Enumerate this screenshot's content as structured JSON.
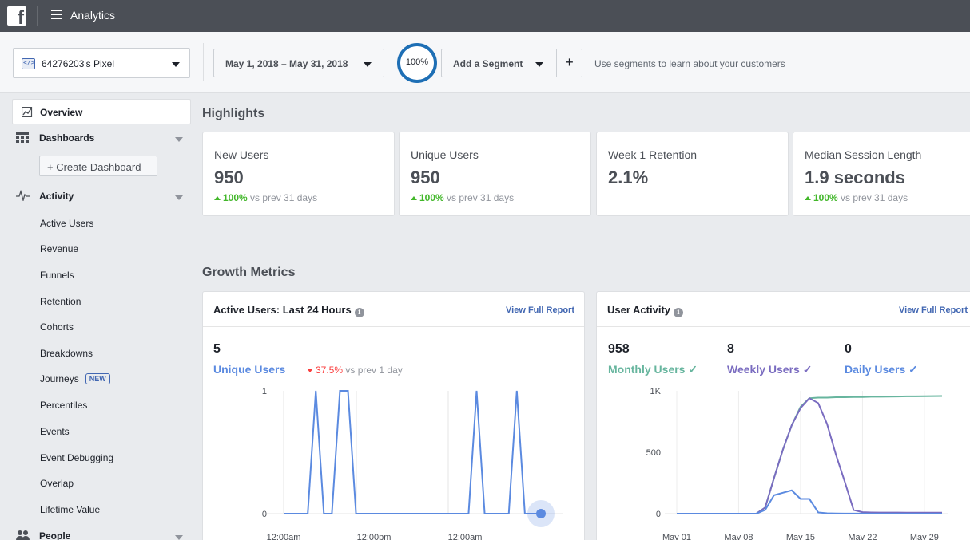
{
  "topbar": {
    "logo": "f",
    "title": "Analytics"
  },
  "toolbar": {
    "pixel_name": "64276203's Pixel",
    "date_range": "May 1, 2018 – May 31, 2018",
    "percent": "100%",
    "segment_label": "Add a Segment",
    "plus_label": "+",
    "segment_hint": "Use segments to learn about your customers"
  },
  "sidebar": {
    "overview": "Overview",
    "dashboards": "Dashboards",
    "create_dashboard": "+ Create Dashboard",
    "activity": "Activity",
    "activity_items": [
      "Active Users",
      "Revenue",
      "Funnels",
      "Retention",
      "Cohorts",
      "Breakdowns",
      "Journeys",
      "Percentiles",
      "Events",
      "Event Debugging",
      "Overlap",
      "Lifetime Value"
    ],
    "new_badge": "NEW",
    "people": "People"
  },
  "highlights": {
    "title": "Highlights",
    "cards": [
      {
        "title": "New Users",
        "value": "950",
        "delta": "100%",
        "delta_text": "vs prev 31 days"
      },
      {
        "title": "Unique Users",
        "value": "950",
        "delta": "100%",
        "delta_text": "vs prev 31 days"
      },
      {
        "title": "Week 1 Retention",
        "value": "2.1%"
      },
      {
        "title": "Median Session Length",
        "value": "1.9 seconds",
        "delta": "100%",
        "delta_text": "vs prev 31 days"
      }
    ]
  },
  "growth": {
    "title": "Growth Metrics",
    "active_users": {
      "title": "Active Users: Last 24 Hours",
      "link": "View Full Report",
      "value": "5",
      "label": "Unique Users",
      "delta": "37.5%",
      "delta_text": "vs prev 1 day"
    },
    "user_activity": {
      "title": "User Activity",
      "link": "View Full Report",
      "monthly_value": "958",
      "monthly_label": "Monthly Users ✓",
      "weekly_value": "8",
      "weekly_label": "Weekly Users ✓",
      "daily_value": "0",
      "daily_label": "Daily Users ✓"
    }
  },
  "colors": {
    "topbar": "#4b4f56",
    "link": "#4267b2",
    "monthly": "#67b59e",
    "weekly": "#7a6cc0",
    "daily": "#5b8ae0",
    "up": "#42b72a",
    "down": "#fa3e3e",
    "ring": "#1e6fb5"
  },
  "icons": {
    "logo": "facebook-logo-icon",
    "menu": "hamburger-menu-icon",
    "pixel": "code-pixel-icon",
    "overview": "chart-box-icon",
    "dashboards": "grid-icon",
    "activity": "pulse-icon",
    "people": "people-icon",
    "info": "info-icon"
  },
  "chart_data": [
    {
      "type": "line",
      "title": "Active Users: Last 24 Hours",
      "x_ticks": [
        "12:00am",
        "12:00pm",
        "12:00am"
      ],
      "y_ticks": [
        "0",
        "1"
      ],
      "ylim": [
        0,
        1
      ],
      "series": [
        {
          "name": "Unique Users",
          "x": [
            0,
            3,
            4,
            5,
            6,
            7,
            8,
            9,
            10,
            11,
            23,
            24,
            25,
            26,
            28,
            29,
            30,
            31,
            32
          ],
          "values": [
            0,
            0,
            1,
            0,
            0,
            1,
            1,
            0,
            0,
            0,
            0,
            1,
            0,
            0,
            0,
            1,
            0,
            0,
            0
          ]
        }
      ]
    },
    {
      "type": "line",
      "title": "User Activity",
      "x_ticks": [
        "May 01",
        "May 08",
        "May 15",
        "May 22",
        "May 29"
      ],
      "y_ticks": [
        "0",
        "500",
        "1K"
      ],
      "ylim": [
        0,
        1000
      ],
      "x": [
        1,
        2,
        3,
        4,
        5,
        6,
        7,
        8,
        9,
        10,
        11,
        12,
        13,
        14,
        15,
        16,
        17,
        18,
        19,
        20,
        21,
        22,
        23,
        24,
        25,
        26,
        27,
        28,
        29,
        30,
        31
      ],
      "series": [
        {
          "name": "Monthly Users",
          "values": [
            0,
            0,
            0,
            0,
            0,
            0,
            0,
            0,
            0,
            0,
            50,
            290,
            520,
            720,
            870,
            940,
            945,
            945,
            948,
            948,
            950,
            950,
            952,
            952,
            953,
            954,
            955,
            955,
            956,
            957,
            958
          ]
        },
        {
          "name": "Weekly Users",
          "values": [
            0,
            0,
            0,
            0,
            0,
            0,
            0,
            0,
            0,
            0,
            50,
            290,
            520,
            720,
            860,
            940,
            900,
            730,
            480,
            260,
            30,
            12,
            10,
            9,
            9,
            9,
            8,
            8,
            8,
            8,
            8
          ]
        },
        {
          "name": "Daily Users",
          "values": [
            0,
            0,
            0,
            0,
            0,
            0,
            0,
            0,
            0,
            0,
            30,
            150,
            170,
            190,
            120,
            120,
            10,
            3,
            2,
            1,
            1,
            1,
            0,
            0,
            0,
            0,
            0,
            0,
            0,
            0,
            0
          ]
        }
      ]
    }
  ]
}
